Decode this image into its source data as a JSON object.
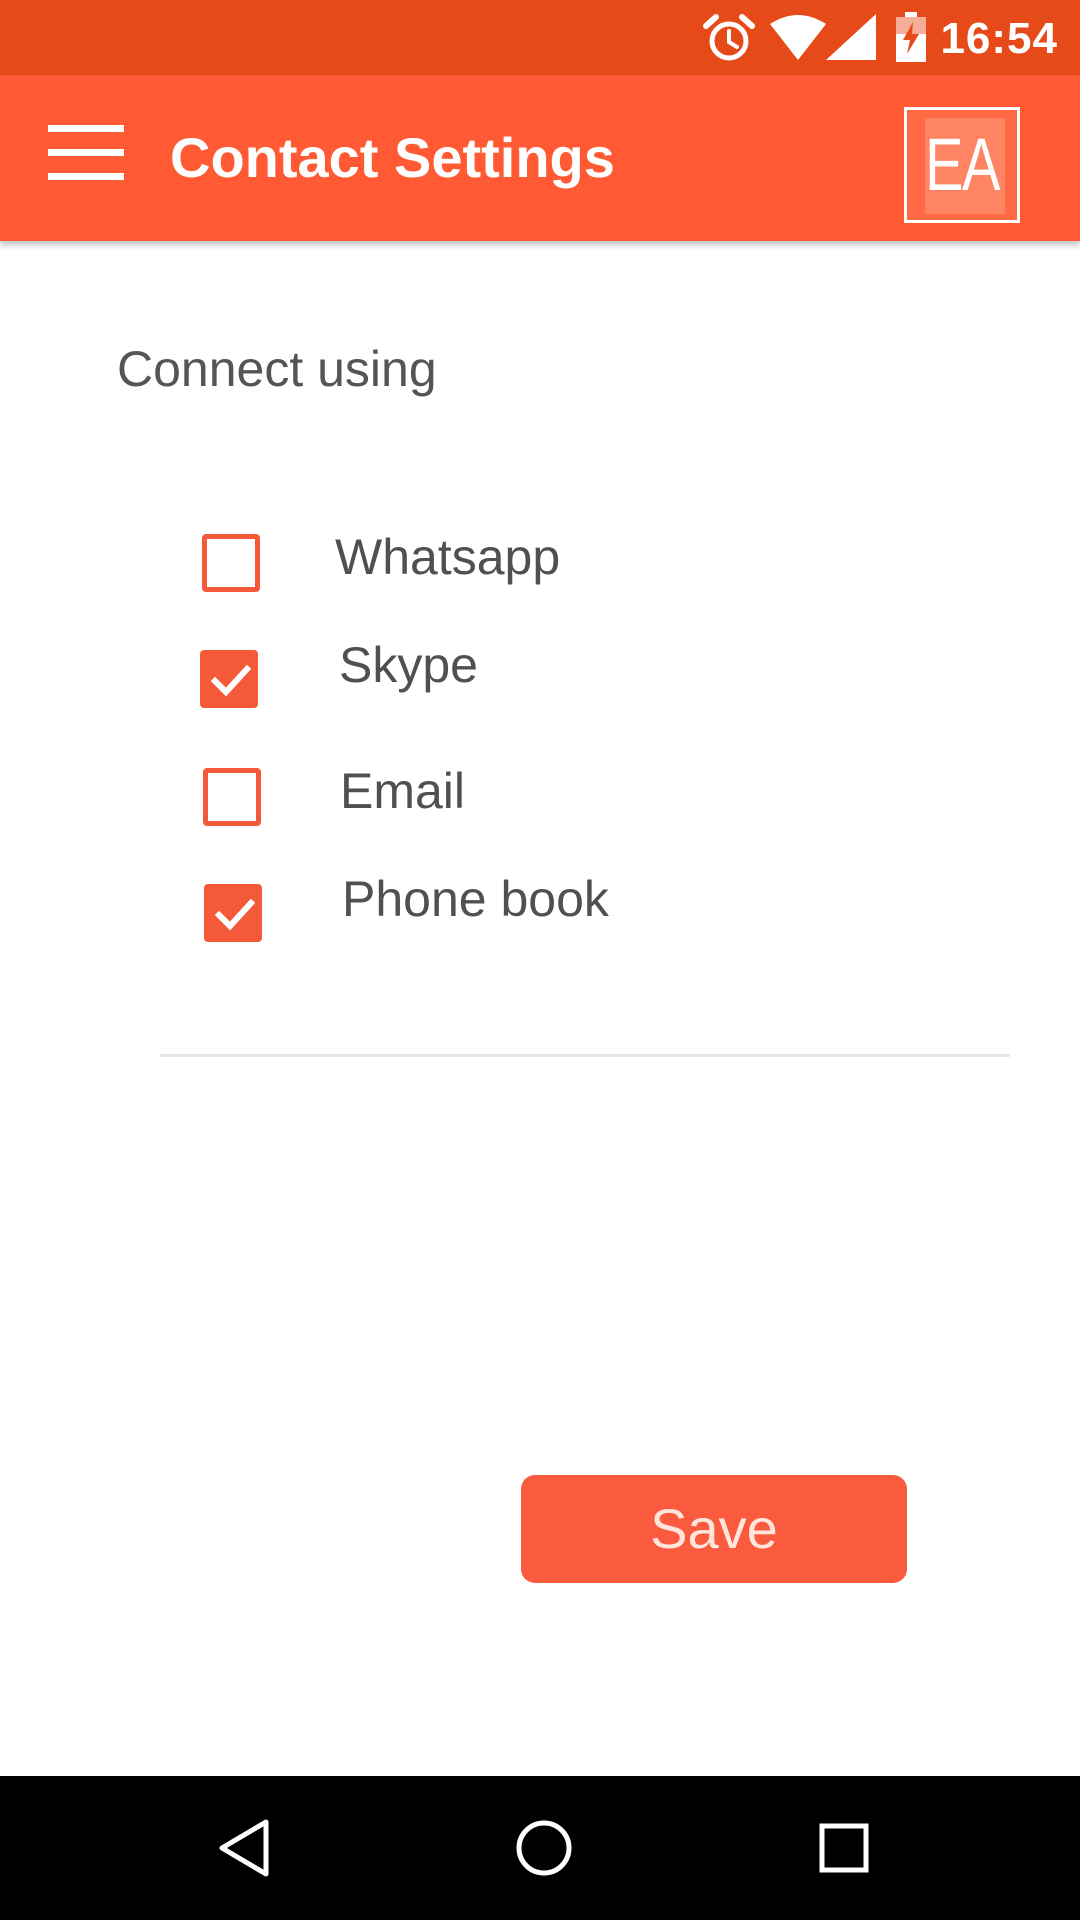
{
  "status_bar": {
    "time": "16:54",
    "icons": [
      "alarm-icon",
      "wifi-icon",
      "signal-icon",
      "battery-charging-icon"
    ]
  },
  "app_bar": {
    "title": "Contact Settings",
    "menu_icon": "hamburger-menu-icon",
    "logo_text": "EA"
  },
  "content": {
    "section_label": "Connect using",
    "options": [
      {
        "label": "Whatsapp",
        "checked": false
      },
      {
        "label": "Skype",
        "checked": true
      },
      {
        "label": "Email",
        "checked": false
      },
      {
        "label": "Phone book",
        "checked": true
      }
    ],
    "save_label": "Save"
  },
  "nav_bar": {
    "icons": [
      "back-icon",
      "home-icon",
      "recents-icon"
    ]
  },
  "colors": {
    "status_bar": "#E64A19",
    "app_bar": "#FF5A33",
    "accent": "#F4593A",
    "text": "#555555"
  }
}
